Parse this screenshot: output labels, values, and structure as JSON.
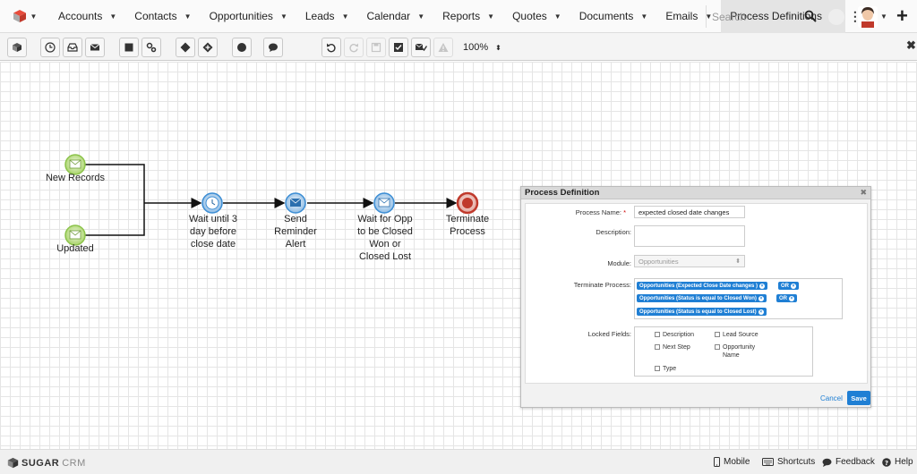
{
  "nav": {
    "items": [
      "Accounts",
      "Contacts",
      "Opportunities",
      "Leads",
      "Calendar",
      "Reports",
      "Quotes",
      "Documents",
      "Emails",
      "Process Definitions"
    ],
    "search_placeholder": "Search"
  },
  "toolbar": {
    "zoom": "100%"
  },
  "canvas": {
    "nodes": {
      "new_records": "New Records",
      "updated": "Updated",
      "wait_3_days": "Wait until 3 day before close date",
      "send_reminder": "Send Reminder Alert",
      "wait_opp": "Wait for Opp to be Closed Won or Closed Lost",
      "terminate": "Terminate Process"
    }
  },
  "dialog": {
    "title": "Process Definition",
    "process_name_label": "Process Name:",
    "process_name_value": "expected closed date changes",
    "description_label": "Description:",
    "module_label": "Module:",
    "module_value": "Opportunities",
    "terminate_label": "Terminate Process:",
    "terminate_pills": [
      "Opportunities (Expected Close Date changes )",
      "Opportunities (Status is equal to Closed Won)",
      "Opportunities (Status is equal to Closed Lost)"
    ],
    "or_label": "OR",
    "locked_label": "Locked Fields:",
    "locked_fields": [
      "Description",
      "Lead Source",
      "Next Step",
      "Opportunity Name",
      "Type"
    ],
    "cancel_label": "Cancel",
    "save_label": "Save"
  },
  "footer": {
    "brand_a": "SUGAR",
    "brand_b": "CRM",
    "mobile": "Mobile",
    "shortcuts": "Shortcuts",
    "feedback": "Feedback",
    "help": "Help"
  },
  "colors": {
    "accent": "#1f7fd4",
    "start_event": "#8cc34b",
    "end_event": "#c0392b"
  }
}
